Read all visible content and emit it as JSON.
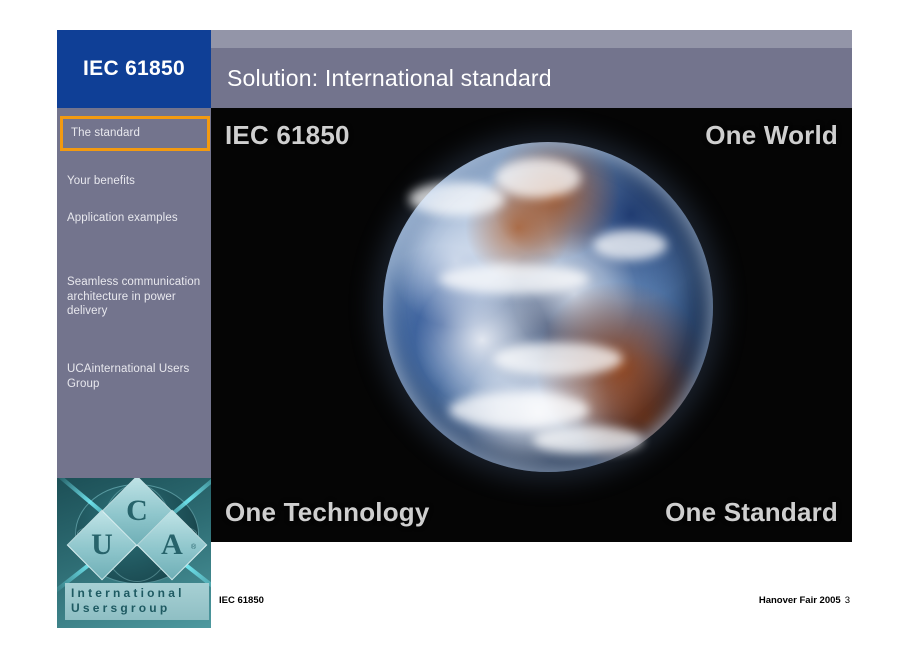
{
  "slide": {
    "brand": {
      "label": "IEC 61850"
    },
    "header": {
      "title": "Solution: International standard"
    },
    "sidebar": {
      "items": [
        {
          "label": "The standard",
          "selected": true
        },
        {
          "label": "Your benefits",
          "selected": false
        },
        {
          "label": "Application examples",
          "selected": false
        },
        {
          "label": "Seamless communication architecture in power delivery",
          "selected": false
        },
        {
          "label": "UCAinternational Users Group",
          "selected": false
        }
      ]
    },
    "logo": {
      "diamond_letters": [
        "U",
        "C",
        "A"
      ],
      "registered_mark": "®",
      "line1": "International",
      "line2": "Usersgroup",
      "image_name": "uca-international-usersgroup-logo"
    },
    "picture": {
      "image_name": "earth-from-space-photo",
      "corner_text": {
        "top_left": "IEC 61850",
        "top_right": "One World",
        "bottom_left": "One Technology",
        "bottom_right": "One Standard"
      }
    },
    "footer": {
      "left": "IEC 61850",
      "event": "Hanover Fair 2005",
      "page": "3"
    },
    "colors": {
      "brand_blue": "#0F3F96",
      "header_strip_gray": "#9395A8",
      "panel_gray": "#73748D",
      "selection_orange": "#F39A10",
      "picture_background": "#050505",
      "overlay_text": "#CFCFCF"
    }
  }
}
